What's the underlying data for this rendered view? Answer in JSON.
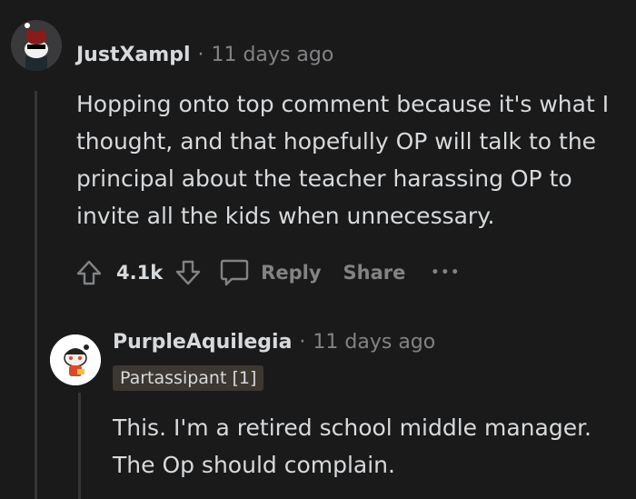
{
  "comments": [
    {
      "username": "JustXampl",
      "separator": "·",
      "time": "11 days ago",
      "body": "Hopping onto top comment because it's what I thought, and that hopefully OP will talk to the principal about the teacher harassing OP to invite all the kids when unnecessary.",
      "vote_count": "4.1k",
      "reply_label": "Reply",
      "share_label": "Share",
      "more_label": "•••"
    },
    {
      "username": "PurpleAquilegia",
      "separator": "·",
      "time": "11 days ago",
      "flair": "Partassipant [1]",
      "body": "This. I'm a retired school middle manager. The Op should complain."
    }
  ]
}
